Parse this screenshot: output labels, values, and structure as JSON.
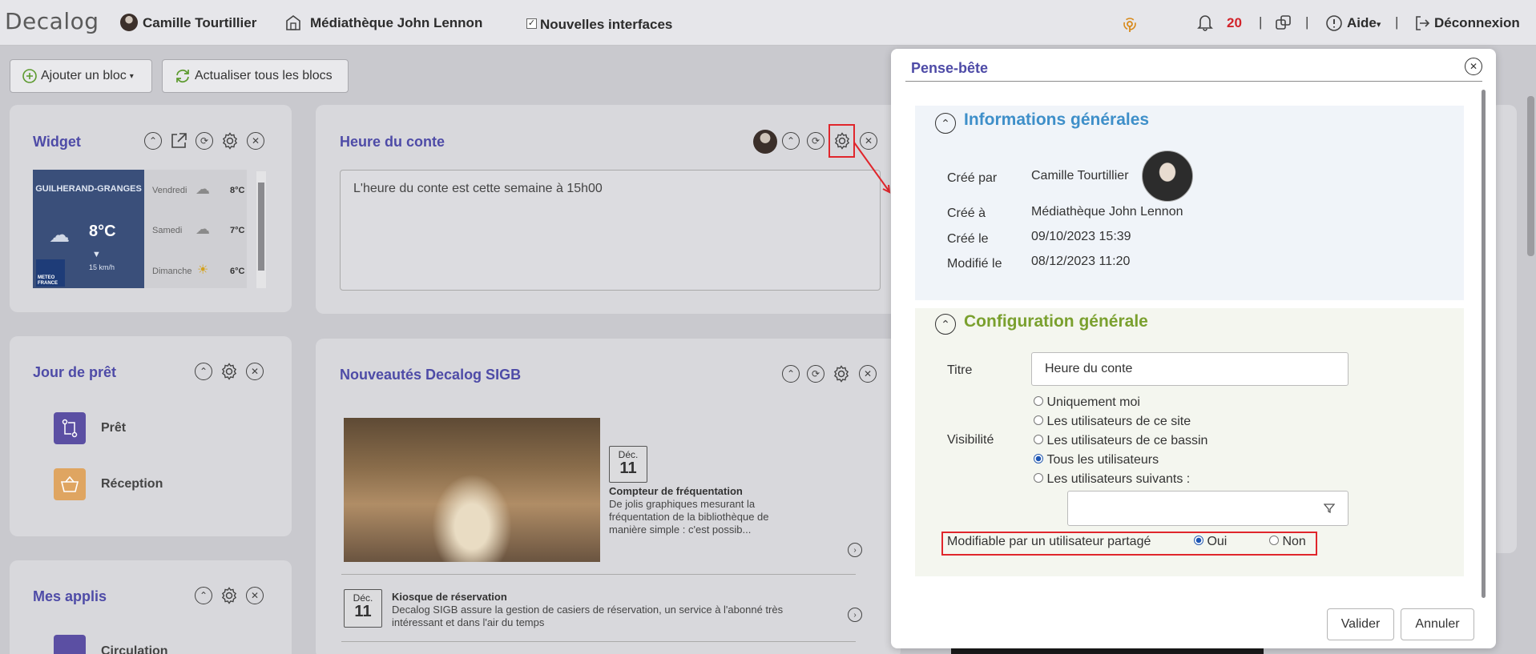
{
  "topbar": {
    "logo": "Decalog",
    "user_name": "Camille Tourtillier",
    "library": "Médiathèque John Lennon",
    "new_ui_label": "Nouvelles interfaces",
    "notif_count": "20",
    "help_label": "Aide",
    "logout_label": "Déconnexion"
  },
  "toolbar": {
    "add_block": "Ajouter un bloc",
    "refresh_all": "Actualiser tous les blocs"
  },
  "widget": {
    "title": "Widget",
    "city": "GUILHERAND-GRANGES",
    "current_temp": "8°C",
    "wind": "15",
    "wind_unit": "km/h",
    "brand": "METEO FRANCE",
    "days": [
      {
        "name": "Vendredi",
        "temp": "8°C"
      },
      {
        "name": "Samedi",
        "temp": "7°C"
      },
      {
        "name": "Dimanche",
        "temp": "6°C"
      }
    ]
  },
  "heure": {
    "title": "Heure du conte",
    "text": "L'heure du conte est cette semaine à 15h00"
  },
  "jour_pret": {
    "title": "Jour de prêt",
    "items": [
      {
        "label": "Prêt"
      },
      {
        "label": "Réception"
      }
    ]
  },
  "mes_applis": {
    "title": "Mes applis",
    "items": [
      {
        "label": "Circulation"
      }
    ]
  },
  "news": {
    "title": "Nouveautés Decalog SIGB",
    "items": [
      {
        "month": "Déc.",
        "day": "11",
        "title": "Compteur de fréquentation",
        "text": "De jolis graphiques mesurant la fréquentation de la bibliothèque de manière simple : c'est possib..."
      },
      {
        "month": "Déc.",
        "day": "11",
        "title": "Kiosque de réservation",
        "text": "Decalog SIGB assure la gestion de casiers de réservation, un service à l'abonné très intéressant et dans l'air du temps"
      }
    ]
  },
  "modal": {
    "title": "Pense-bête",
    "info": {
      "heading": "Informations générales",
      "rows": [
        {
          "label": "Créé par",
          "value": "Camille Tourtillier"
        },
        {
          "label": "Créé à",
          "value": "Médiathèque John Lennon"
        },
        {
          "label": "Créé le",
          "value": "09/10/2023 15:39"
        },
        {
          "label": "Modifié le",
          "value": "08/12/2023 11:20"
        }
      ]
    },
    "config": {
      "heading": "Configuration générale",
      "titre_label": "Titre",
      "titre_value": "Heure du conte",
      "visibility_label": "Visibilité",
      "visibility_options": [
        {
          "label": "Uniquement moi",
          "selected": false
        },
        {
          "label": "Les utilisateurs de ce site",
          "selected": false
        },
        {
          "label": "Les utilisateurs de ce bassin",
          "selected": false
        },
        {
          "label": "Tous les utilisateurs",
          "selected": true
        },
        {
          "label": "Les utilisateurs suivants :",
          "selected": false
        }
      ],
      "modifiable_label": "Modifiable par un utilisateur partagé",
      "oui": "Oui",
      "non": "Non",
      "modifiable_value": "Oui"
    },
    "buttons": {
      "validate": "Valider",
      "cancel": "Annuler"
    }
  },
  "colors": {
    "card_title": "#4e4ba7",
    "info_heading": "#3e8fc9",
    "config_heading": "#7aa02e",
    "highlight": "#e0262c",
    "notif": "#d2232a"
  }
}
